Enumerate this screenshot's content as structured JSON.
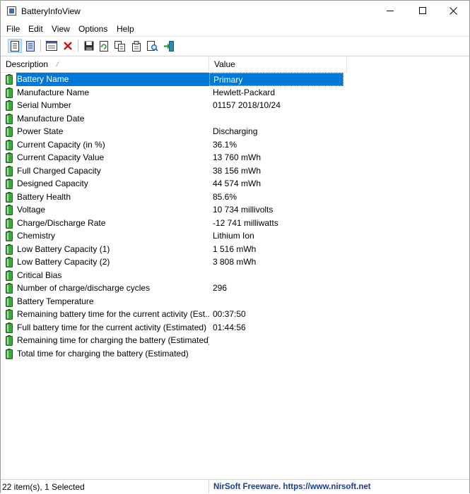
{
  "window": {
    "title": "BatteryInfoView",
    "colors": {
      "selection": "#0078d7",
      "battery_icon": "#3aa83a",
      "link": "#1a3d8f"
    }
  },
  "menu": [
    "File",
    "Edit",
    "View",
    "Options",
    "Help"
  ],
  "toolbar": [
    {
      "name": "battery-info-mode-icon"
    },
    {
      "name": "battery-log-mode-icon"
    },
    {
      "name": "properties-window-icon"
    },
    {
      "name": "delete-icon"
    },
    {
      "name": "save-icon"
    },
    {
      "name": "refresh-icon"
    },
    {
      "name": "copy-icon"
    },
    {
      "name": "properties-icon"
    },
    {
      "name": "find-icon"
    },
    {
      "name": "exit-icon"
    }
  ],
  "columns": {
    "description": "Description",
    "value": "Value"
  },
  "rows": [
    {
      "d": "Battery Name",
      "v": "Primary"
    },
    {
      "d": "Manufacture Name",
      "v": "Hewlett-Packard"
    },
    {
      "d": "Serial Number",
      "v": "01157 2018/10/24"
    },
    {
      "d": "Manufacture Date",
      "v": ""
    },
    {
      "d": "Power State",
      "v": "Discharging"
    },
    {
      "d": "Current Capacity (in %)",
      "v": "36.1%"
    },
    {
      "d": "Current Capacity Value",
      "v": "13 760 mWh"
    },
    {
      "d": "Full Charged Capacity",
      "v": "38 156 mWh"
    },
    {
      "d": "Designed Capacity",
      "v": "44 574 mWh"
    },
    {
      "d": "Battery Health",
      "v": "85.6%"
    },
    {
      "d": "Voltage",
      "v": "10 734 millivolts"
    },
    {
      "d": "Charge/Discharge Rate",
      "v": "-12 741 milliwatts"
    },
    {
      "d": "Chemistry",
      "v": "Lithium Ion"
    },
    {
      "d": "Low Battery Capacity (1)",
      "v": "1 516 mWh"
    },
    {
      "d": "Low Battery Capacity (2)",
      "v": "3 808 mWh"
    },
    {
      "d": "Critical Bias",
      "v": ""
    },
    {
      "d": "Number of charge/discharge cycles",
      "v": "296"
    },
    {
      "d": "Battery Temperature",
      "v": ""
    },
    {
      "d": "Remaining battery time for the current activity (Est...",
      "v": "00:37:50"
    },
    {
      "d": "Full battery time for the current activity (Estimated)",
      "v": "01:44:56"
    },
    {
      "d": "Remaining time for charging the battery (Estimated)",
      "v": ""
    },
    {
      "d": "Total  time for charging the battery (Estimated)",
      "v": ""
    }
  ],
  "selected_index": 0,
  "status": {
    "items": "22 item(s), 1 Selected",
    "credit": "NirSoft Freeware. https://www.nirsoft.net"
  }
}
